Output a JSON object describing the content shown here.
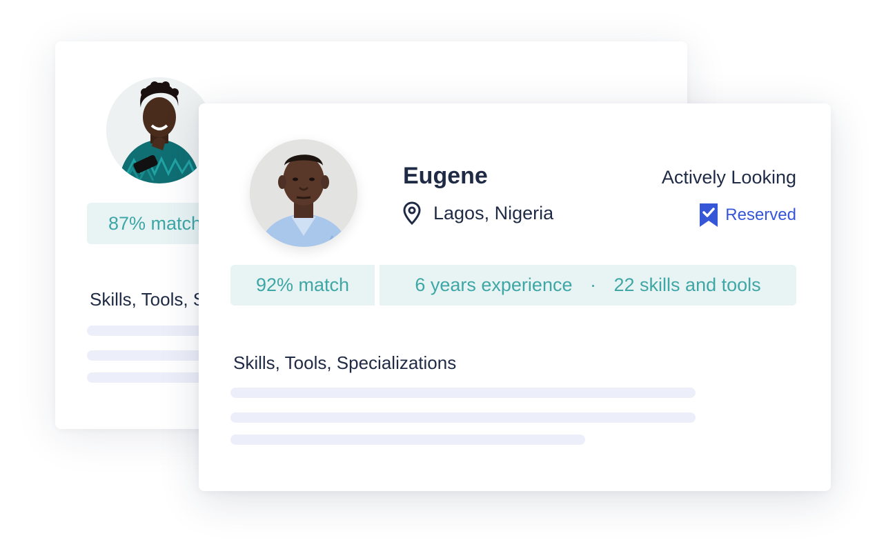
{
  "back_card": {
    "match": "87% match",
    "skills_title": "Skills, Tools, Specializations"
  },
  "profile": {
    "name": "Eugene",
    "location": "Lagos, Nigeria",
    "status": "Actively Looking",
    "reserved_label": "Reserved",
    "match": "92% match",
    "experience": "6 years experience",
    "separator": "·",
    "skills_count": "22 skills and tools",
    "skills_title": "Skills, Tools, Specializations"
  },
  "icons": {
    "location": "map-pin-icon",
    "reserved": "bookmark-check-icon"
  },
  "colors": {
    "accent_teal": "#3fa6a6",
    "pill_bg": "#e8f4f4",
    "reserved_blue": "#3656d8",
    "text_dark": "#1f2a44",
    "placeholder_line": "#eceff9"
  }
}
